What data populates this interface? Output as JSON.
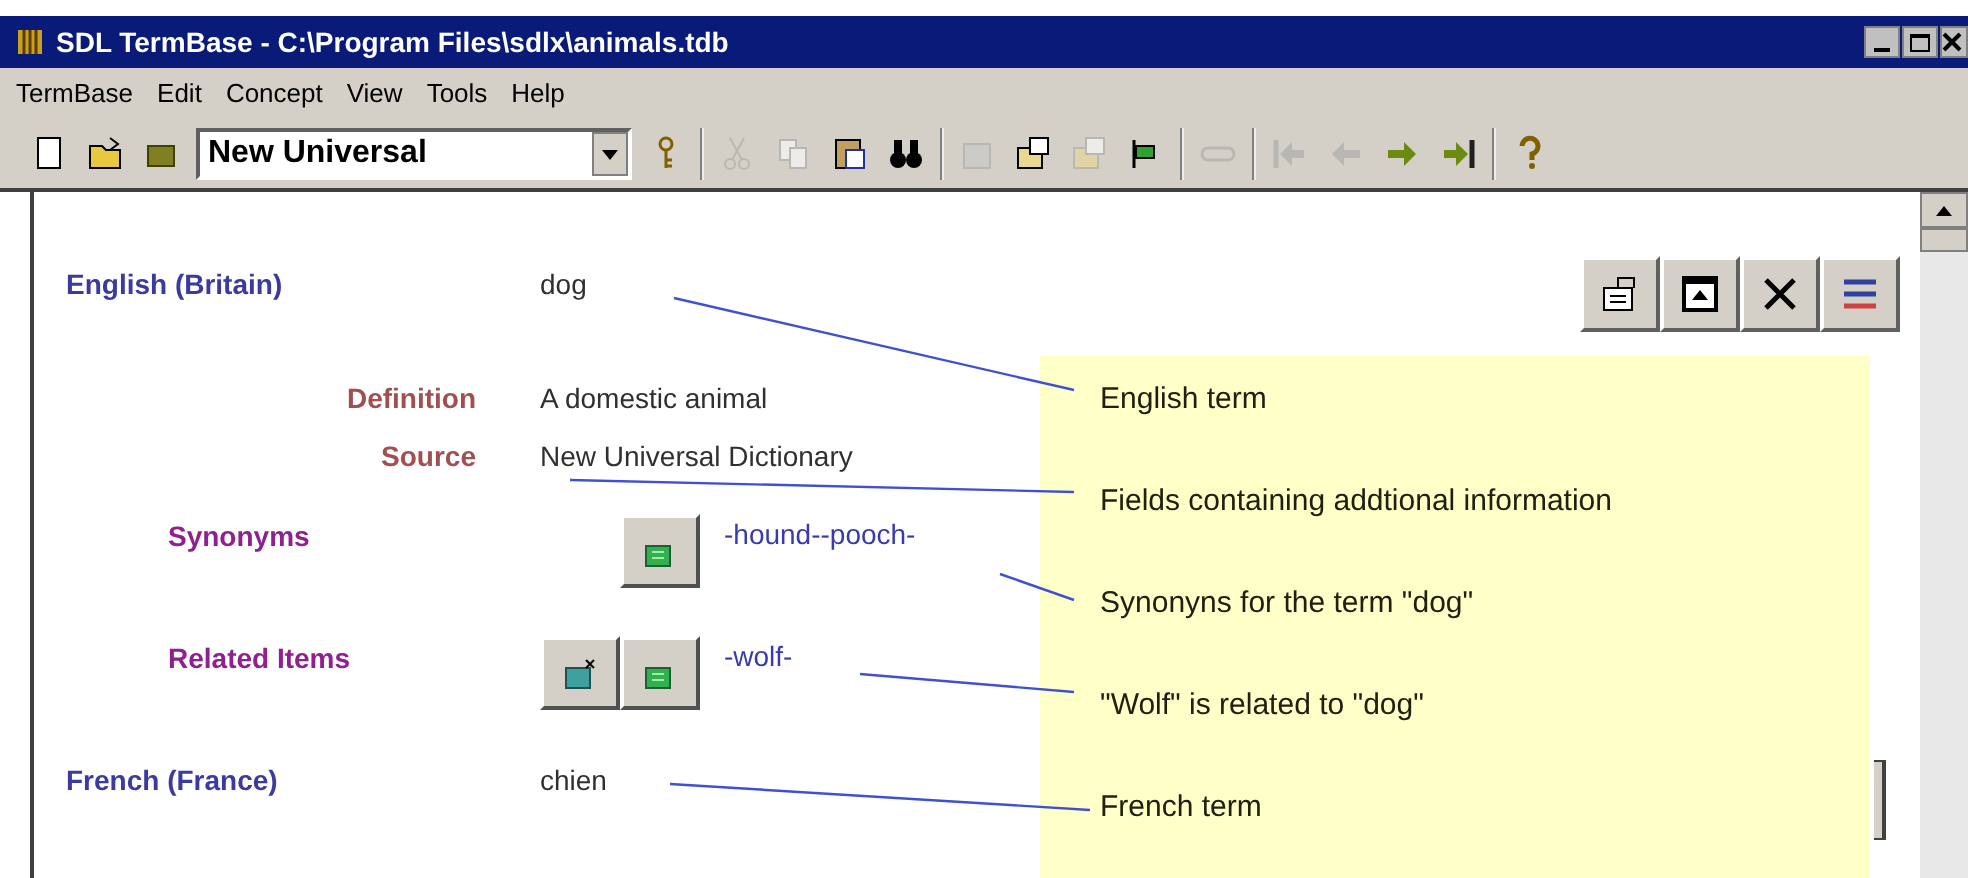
{
  "window": {
    "title": "SDL TermBase - C:\\Program Files\\sdlx\\animals.tdb"
  },
  "menu": [
    "TermBase",
    "Edit",
    "Concept",
    "View",
    "Tools",
    "Help"
  ],
  "toolbar": [
    {
      "kind": "new",
      "disabled": false
    },
    {
      "kind": "open",
      "disabled": false
    },
    {
      "kind": "folder",
      "disabled": false
    },
    {
      "kind": "combo",
      "value": "New Universal"
    },
    {
      "kind": "key",
      "disabled": false
    },
    {
      "kind": "sep"
    },
    {
      "kind": "cut",
      "disabled": true
    },
    {
      "kind": "copy",
      "disabled": true
    },
    {
      "kind": "paste",
      "disabled": false
    },
    {
      "kind": "find",
      "disabled": false
    },
    {
      "kind": "sep"
    },
    {
      "kind": "edit",
      "disabled": true
    },
    {
      "kind": "form",
      "disabled": false
    },
    {
      "kind": "form",
      "disabled": true
    },
    {
      "kind": "flag",
      "disabled": false
    },
    {
      "kind": "sep"
    },
    {
      "kind": "link",
      "disabled": true
    },
    {
      "kind": "sep"
    },
    {
      "kind": "first",
      "disabled": true
    },
    {
      "kind": "prev",
      "disabled": true
    },
    {
      "kind": "next",
      "disabled": false
    },
    {
      "kind": "last",
      "disabled": false
    },
    {
      "kind": "sep"
    },
    {
      "kind": "help",
      "disabled": false
    }
  ],
  "entry": [
    {
      "kind": "language",
      "label": "English (Britain)",
      "value": "dog"
    },
    {
      "kind": "field",
      "label": "Definition",
      "value": "A domestic animal"
    },
    {
      "kind": "field",
      "label": "Source",
      "value": "New Universal Dictionary"
    },
    {
      "kind": "crossref",
      "label": "Synonyms",
      "buttons": [
        {
          "kind": "add"
        }
      ],
      "value": "-hound--pooch-"
    },
    {
      "kind": "crossref",
      "label": "Related Items",
      "buttons": [
        {
          "kind": "remove"
        },
        {
          "kind": "add"
        }
      ],
      "value": "-wolf-"
    },
    {
      "kind": "language",
      "label": "French (France)",
      "value": "chien"
    }
  ],
  "notes": [
    "English term",
    "Fields containing addtional information",
    "Synonyns for the term \"dog\"",
    "\"Wolf\" is related to \"dog\"",
    "French term"
  ]
}
